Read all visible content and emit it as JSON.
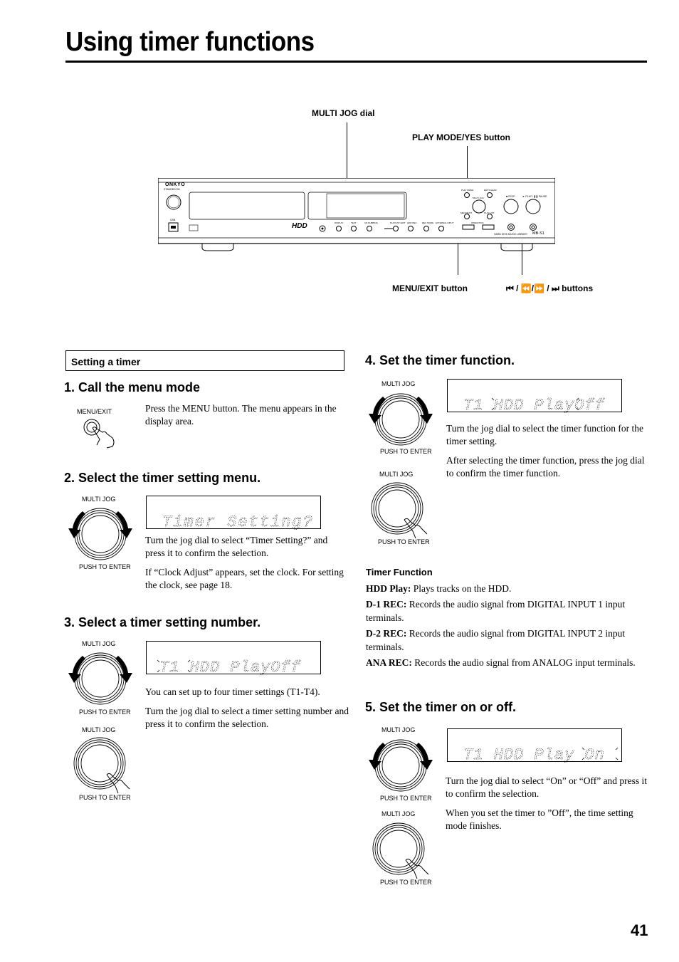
{
  "page": {
    "title": "Using timer functions",
    "page_number": "41"
  },
  "diagram": {
    "callouts": {
      "multi_jog_dial": "MULTI JOG dial",
      "play_mode_yes": "PLAY MODE/YES button",
      "menu_exit": "MENU/EXIT button",
      "skip_search": "⏮ / ⏪/⏩ / ⏭ buttons"
    },
    "device": {
      "brand": "ONKYO",
      "standby_label": "STANDBY/ON",
      "usb_label": "USB",
      "hdd_logo": "HDD",
      "model": "MB-S1",
      "model_caption": "HARD DISK MUSIC LIBRARY",
      "buttons": [
        "DISPLAY",
        "TEXT",
        "CD DUBBING",
        "PLAYLIST EDIT",
        "HDD REC",
        "REC MODE",
        "EXTERNAL INPUT"
      ],
      "right_labels": {
        "play_mode": "PLAY MODE",
        "yes": "YES",
        "edit_clear": "EDIT/CLEAR",
        "no": "NO",
        "multi_jog": "MULTI JOG",
        "menu_exit": "MENU/EXIT",
        "push_to_enter": "PUSH TO ENTER",
        "play_list": "PLAY LIST",
        "operation": "OPERATION",
        "stop": "■ STOP",
        "play_pause": "► PLAY / ❚❚ PAUSE"
      }
    }
  },
  "section": {
    "heading": "Setting a timer"
  },
  "steps": [
    {
      "heading": "1. Call the menu mode",
      "icon_label": "MENU/EXIT",
      "paragraphs": [
        "Press the MENU button. The menu appears in the display area."
      ]
    },
    {
      "heading": "2. Select the timer setting menu.",
      "jog_label": "MULTI JOG",
      "jog_caption": "PUSH TO ENTER",
      "display": "Timer Setting?",
      "paragraphs": [
        "Turn the jog dial to select “Timer Setting?” and press it to confirm the selection.",
        "If “Clock Adjust” appears, set the clock. For setting the clock, see page 18."
      ]
    },
    {
      "heading": "3. Select a timer setting number.",
      "jog_label": "MULTI JOG",
      "jog_caption": "PUSH TO ENTER",
      "jog2_label": "MULTI JOG",
      "jog2_caption": "PUSH TO ENTER",
      "display": "T1 HDD PlayOff",
      "blinking": "T1",
      "paragraphs": [
        "You can set up to four timer settings (T1-T4).",
        "Turn the jog dial to select a timer setting number and press it to confirm the selection."
      ]
    },
    {
      "heading": "4. Set the timer function.",
      "jog_label": "MULTI JOG",
      "jog_caption": "PUSH TO ENTER",
      "jog2_label": "MULTI JOG",
      "jog2_caption": "PUSH TO ENTER",
      "display": "T1 HDD PlayOff",
      "blinking": "HDD Play",
      "paragraphs": [
        "Turn the jog dial to select the timer function for the timer setting.",
        "After selecting the timer function, press the jog dial to confirm the timer function."
      ]
    },
    {
      "heading": "5. Set the timer on or off.",
      "jog_label": "MULTI JOG",
      "jog_caption": "PUSH TO ENTER",
      "jog2_label": "MULTI JOG",
      "jog2_caption": "PUSH TO ENTER",
      "display": "T1 HDD Play On",
      "blinking": "On",
      "paragraphs": [
        "Turn the jog dial to select “On” or “Off” and press it to confirm the selection.",
        "When you set the timer to ”Off”, the time setting mode finishes."
      ]
    }
  ],
  "timer_function": {
    "heading": "Timer Function",
    "items": [
      {
        "term": "HDD Play:",
        "desc": " Plays tracks on the HDD."
      },
      {
        "term": "D-1 REC:",
        "desc": " Records the audio signal from DIGITAL INPUT 1 input terminals."
      },
      {
        "term": "D-2 REC:",
        "desc": " Records the audio signal from DIGITAL INPUT 2 input terminals."
      },
      {
        "term": "ANA REC:",
        "desc": " Records the audio signal from ANALOG input terminals."
      }
    ]
  }
}
